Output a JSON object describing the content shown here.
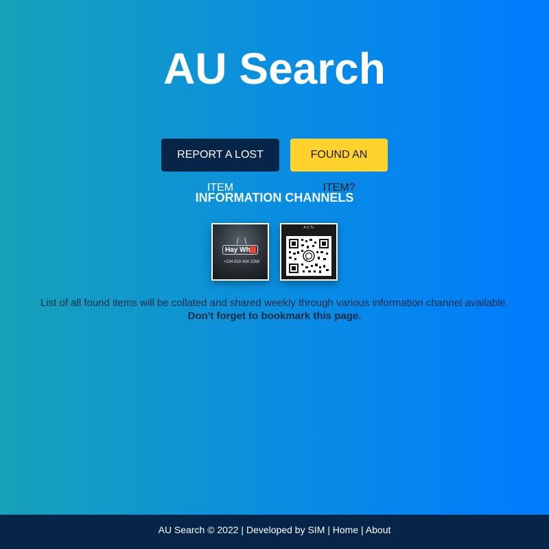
{
  "app": {
    "title": "AU Search"
  },
  "actions": {
    "report_label": "REPORT A LOST ITEM",
    "found_label": "FOUND AN ITEM?"
  },
  "channels": {
    "heading": "INFORMATION CHANNELS",
    "items": [
      {
        "name": "Hay Why",
        "logo_text": "Hay Why",
        "phone": "+234 810 434 2268",
        "icon": "hay-why-logo"
      },
      {
        "name": "AUTv WhatsApp",
        "caption": "A U Tv",
        "icon": "whatsapp-qr-code"
      }
    ]
  },
  "notice": {
    "line1": "List of all found items will be collated and shared weekly through various information channel available.",
    "line2": "Don't forget to bookmark this page."
  },
  "footer": {
    "copyright": "AU Search © 2022 | Developed by SIM | ",
    "home_label": "Home",
    "separator": " | ",
    "about_label": "About"
  },
  "colors": {
    "gradient_start": "#17a2b8",
    "gradient_end": "#007bff",
    "navy": "#072449",
    "yellow": "#ffd22e"
  }
}
